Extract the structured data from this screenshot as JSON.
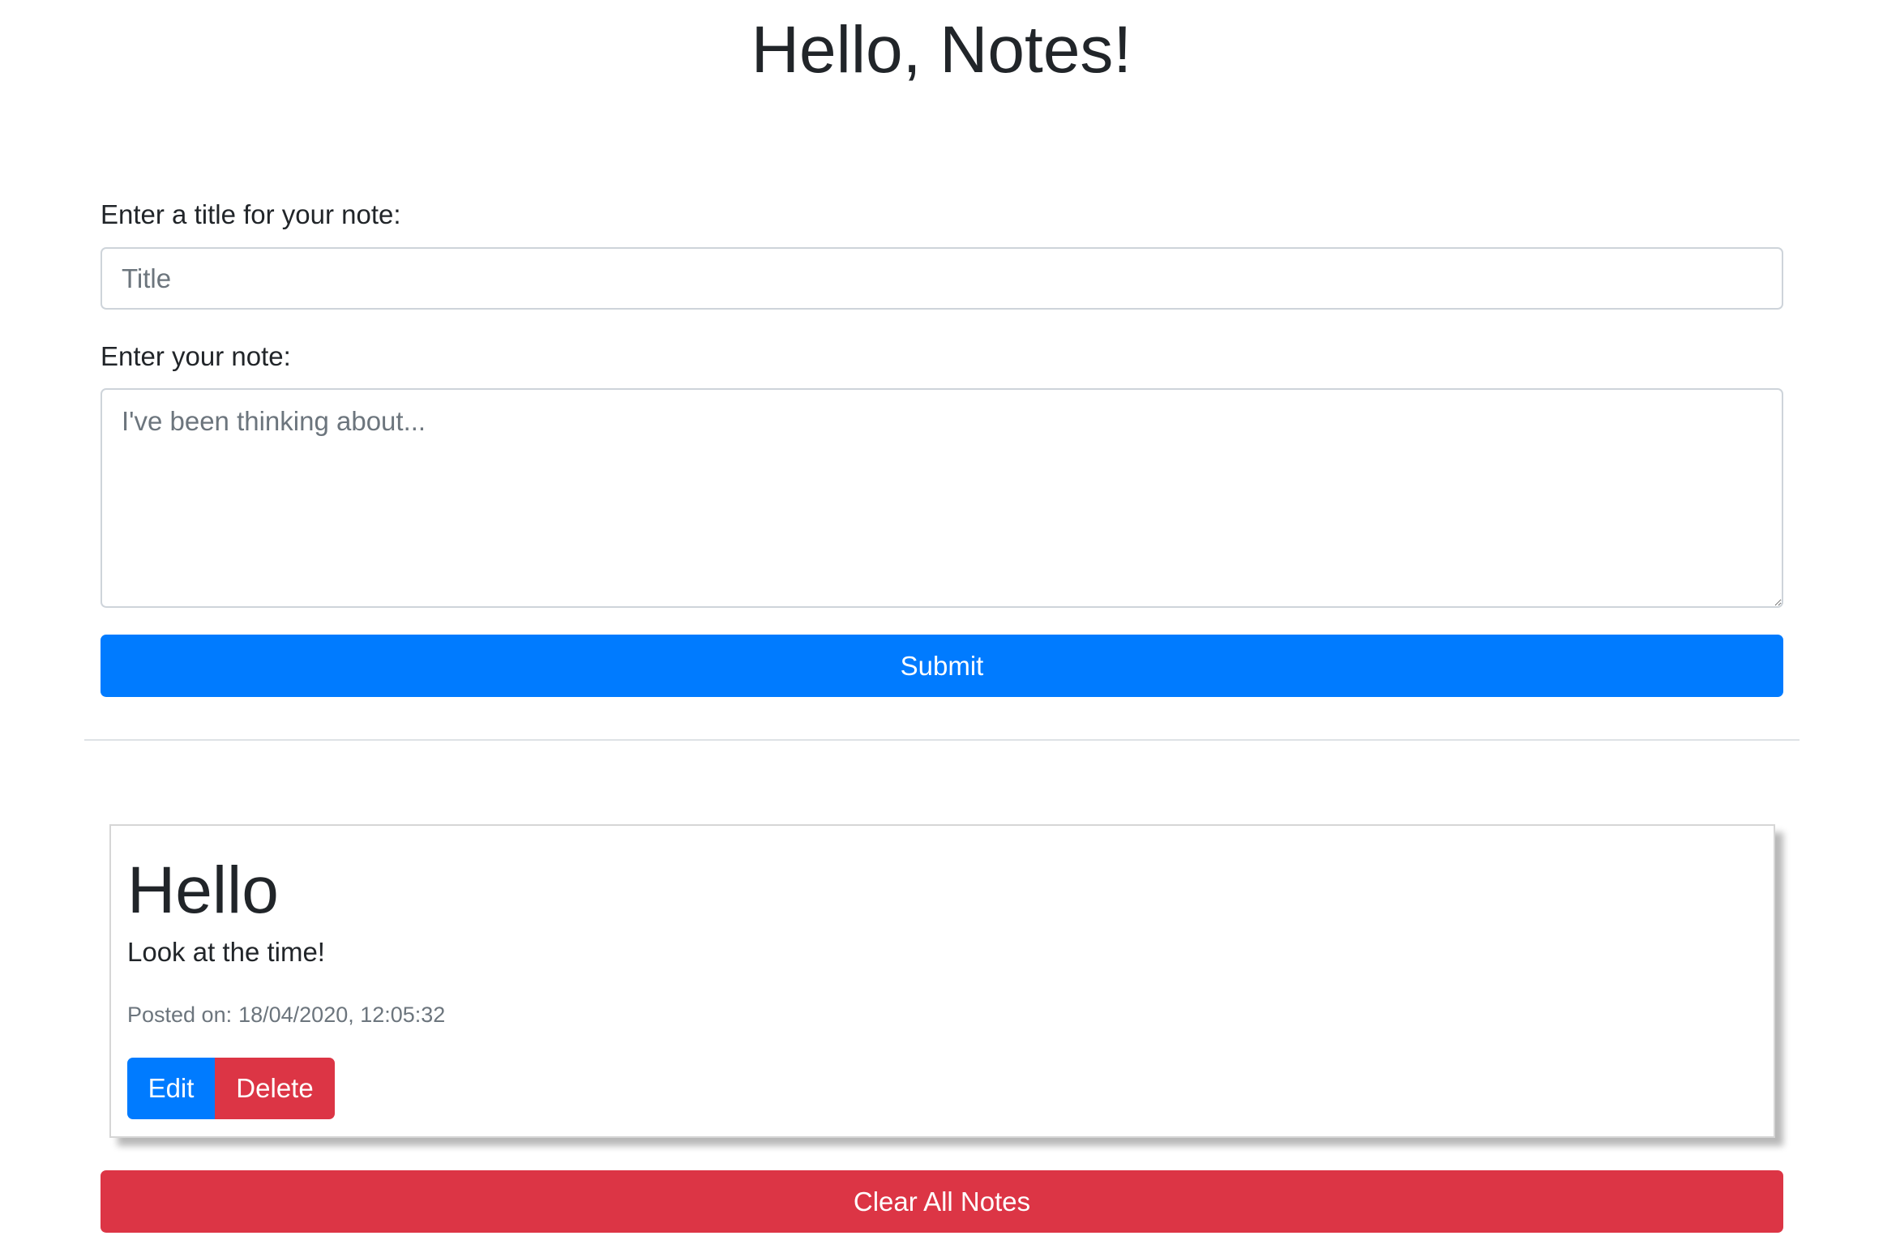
{
  "header": {
    "title": "Hello, Notes!"
  },
  "form": {
    "title_label": "Enter a title for your note:",
    "title_placeholder": "Title",
    "title_value": "",
    "note_label": "Enter your note:",
    "note_placeholder": "I've been thinking about...",
    "note_value": "",
    "submit_label": "Submit"
  },
  "notes": [
    {
      "title": "Hello",
      "body": "Look at the time!",
      "posted_prefix": "Posted on:",
      "posted_at": "18/04/2020, 12:05:32",
      "edit_label": "Edit",
      "delete_label": "Delete"
    }
  ],
  "actions": {
    "clear_all_label": "Clear All Notes"
  },
  "colors": {
    "primary": "#007bff",
    "danger": "#dc3545",
    "muted_text": "#6c757d",
    "border": "#ced4da"
  }
}
